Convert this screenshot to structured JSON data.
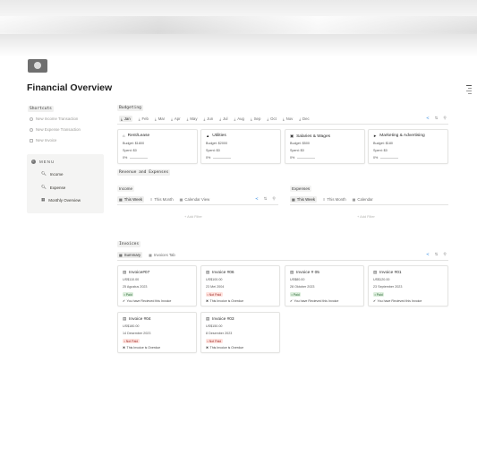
{
  "page": {
    "title": "Financial Overview",
    "icon": "money-icon"
  },
  "shortcuts": {
    "heading": "Shortcuts",
    "items": [
      "New Income Transaction",
      "New Expense Transaction",
      "New Invoice"
    ]
  },
  "menu": {
    "heading": "MENU",
    "items": [
      {
        "label": "Income",
        "icon": "search-icon"
      },
      {
        "label": "Expense",
        "icon": "search-icon"
      },
      {
        "label": "Monthly Overview",
        "icon": "calendar-icon"
      }
    ]
  },
  "budgeting": {
    "heading": "Budgeting",
    "months": [
      "Jan",
      "Feb",
      "Mar",
      "Apr",
      "May",
      "Jun",
      "Jul",
      "Aug",
      "Sep",
      "Oct",
      "Nov",
      "Dec"
    ],
    "active_month": "Jan",
    "cards": [
      {
        "title": "Rent/Lease",
        "budget": "Budget: $1800",
        "spent": "Spent: $0",
        "progress": "0%",
        "icon": "home-icon"
      },
      {
        "title": "Utilities",
        "budget": "Budget: $2000",
        "spent": "Spent: $0",
        "progress": "0%",
        "icon": "lamp-icon"
      },
      {
        "title": "Salaries & Wages",
        "budget": "Budget: $500",
        "spent": "Spent: $0",
        "progress": "0%",
        "icon": "wallet-icon"
      },
      {
        "title": "Marketing & Advertising",
        "budget": "Budget: $180",
        "spent": "Spent: $0",
        "progress": "0%",
        "icon": "megaphone-icon"
      }
    ]
  },
  "revenue": {
    "heading": "Revenue and Expenses",
    "income": {
      "label": "Income",
      "tabs": [
        "This Week",
        "This Month",
        "Calendar View"
      ],
      "add_filter": "Add Filter"
    },
    "expenses": {
      "label": "Expenses",
      "tabs": [
        "This Week",
        "This Month",
        "Calendar"
      ],
      "add_filter": "Add Filter"
    }
  },
  "invoices": {
    "heading": "Invoices",
    "tabs": [
      "Summary",
      "Invoices Tab"
    ],
    "cards": [
      {
        "title": "Invoice#07",
        "amount": "US$110.00",
        "date": "25 Agustus 2023",
        "status_pill": "Paid",
        "paid": true,
        "message": "You have Recieved this Invoice"
      },
      {
        "title": "Invoice #06",
        "amount": "US$100.00",
        "date": "23 Mei 2004",
        "status_pill": "Not Paid",
        "paid": false,
        "message": "This Invoice is Overdue"
      },
      {
        "title": "Invoice # 05",
        "amount": "US$80.00",
        "date": "28 Oktober 2023",
        "status_pill": "Paid",
        "paid": true,
        "message": "You have Recieved this Invoice"
      },
      {
        "title": "Invoice  #01",
        "amount": "US$120.00",
        "date": "23 September 2023",
        "status_pill": "Paid",
        "paid": true,
        "message": "You have Recieved this Invoice"
      },
      {
        "title": "Invoice #04",
        "amount": "US$180.00",
        "date": "14 Desember 2023",
        "status_pill": "Not Paid",
        "paid": false,
        "message": "This Invoice is Overdue"
      },
      {
        "title": "Invoice #03",
        "amount": "US$150.00",
        "date": "8 Desember 2023",
        "status_pill": "Not Paid",
        "paid": false,
        "message": "This Invoice is Overdue"
      }
    ]
  },
  "colors": {
    "accent": "#2383e2",
    "paid_bg": "#dbeddb",
    "not_paid_bg": "#ffe2dd"
  }
}
